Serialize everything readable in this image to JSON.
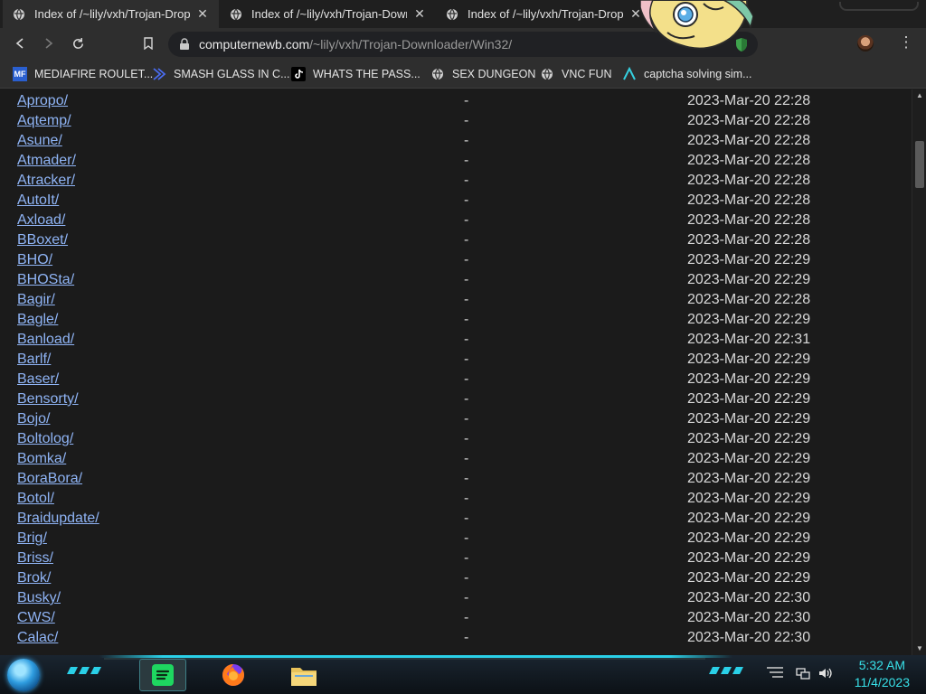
{
  "browser": {
    "tabs": [
      {
        "title": "Index of /~lily/vxh/Trojan-Dropper",
        "active": true
      },
      {
        "title": "Index of /~lily/vxh/Trojan-Downloader",
        "active": false
      },
      {
        "title": "Index of /~lily/vxh/Trojan-Dropper",
        "active": false
      }
    ],
    "close_glyph": "✕",
    "url_host": "computernewb.com",
    "url_path": "/~lily/vxh/Trojan-Downloader/Win32/",
    "menu_glyph": "⋮"
  },
  "bookmarks": [
    {
      "label": "MEDIAFIRE ROULET...",
      "icon": "mediafire-icon",
      "icon_text": "MF"
    },
    {
      "label": "SMASH GLASS IN C...",
      "icon": "bracket-icon"
    },
    {
      "label": "WHATS THE PASS...",
      "icon": "tiktok-icon"
    },
    {
      "label": "SEX DUNGEON",
      "icon": "globe-icon"
    },
    {
      "label": "VNC FUN",
      "icon": "globe-icon"
    },
    {
      "label": "captcha solving sim...",
      "icon": "arrow-a-icon"
    }
  ],
  "listing": {
    "rows": [
      {
        "name": "Apropo/",
        "size": "-",
        "date": "2023-Mar-20 22:28"
      },
      {
        "name": "Aqtemp/",
        "size": "-",
        "date": "2023-Mar-20 22:28"
      },
      {
        "name": "Asune/",
        "size": "-",
        "date": "2023-Mar-20 22:28"
      },
      {
        "name": "Atmader/",
        "size": "-",
        "date": "2023-Mar-20 22:28"
      },
      {
        "name": "Atracker/",
        "size": "-",
        "date": "2023-Mar-20 22:28"
      },
      {
        "name": "AutoIt/",
        "size": "-",
        "date": "2023-Mar-20 22:28"
      },
      {
        "name": "Axload/",
        "size": "-",
        "date": "2023-Mar-20 22:28"
      },
      {
        "name": "BBoxet/",
        "size": "-",
        "date": "2023-Mar-20 22:28"
      },
      {
        "name": "BHO/",
        "size": "-",
        "date": "2023-Mar-20 22:29"
      },
      {
        "name": "BHOSta/",
        "size": "-",
        "date": "2023-Mar-20 22:29"
      },
      {
        "name": "Bagir/",
        "size": "-",
        "date": "2023-Mar-20 22:28"
      },
      {
        "name": "Bagle/",
        "size": "-",
        "date": "2023-Mar-20 22:29"
      },
      {
        "name": "Banload/",
        "size": "-",
        "date": "2023-Mar-20 22:31"
      },
      {
        "name": "Barlf/",
        "size": "-",
        "date": "2023-Mar-20 22:29"
      },
      {
        "name": "Baser/",
        "size": "-",
        "date": "2023-Mar-20 22:29"
      },
      {
        "name": "Bensorty/",
        "size": "-",
        "date": "2023-Mar-20 22:29"
      },
      {
        "name": "Bojo/",
        "size": "-",
        "date": "2023-Mar-20 22:29"
      },
      {
        "name": "Boltolog/",
        "size": "-",
        "date": "2023-Mar-20 22:29"
      },
      {
        "name": "Bomka/",
        "size": "-",
        "date": "2023-Mar-20 22:29"
      },
      {
        "name": "BoraBora/",
        "size": "-",
        "date": "2023-Mar-20 22:29"
      },
      {
        "name": "Botol/",
        "size": "-",
        "date": "2023-Mar-20 22:29"
      },
      {
        "name": "Braidupdate/",
        "size": "-",
        "date": "2023-Mar-20 22:29"
      },
      {
        "name": "Brig/",
        "size": "-",
        "date": "2023-Mar-20 22:29"
      },
      {
        "name": "Briss/",
        "size": "-",
        "date": "2023-Mar-20 22:29"
      },
      {
        "name": "Brok/",
        "size": "-",
        "date": "2023-Mar-20 22:29"
      },
      {
        "name": "Busky/",
        "size": "-",
        "date": "2023-Mar-20 22:30"
      },
      {
        "name": "CWS/",
        "size": "-",
        "date": "2023-Mar-20 22:30"
      },
      {
        "name": "Calac/",
        "size": "-",
        "date": "2023-Mar-20 22:30"
      }
    ]
  },
  "scrollbar": {
    "up_glyph": "▲",
    "down_glyph": "▼"
  },
  "taskbar": {
    "apps": [
      {
        "name": "spotify-icon",
        "active": true
      },
      {
        "name": "firefox-icon",
        "active": false
      },
      {
        "name": "file-explorer-icon",
        "active": false
      }
    ],
    "clock_time": "5:32 AM",
    "clock_date": "11/4/2023"
  }
}
